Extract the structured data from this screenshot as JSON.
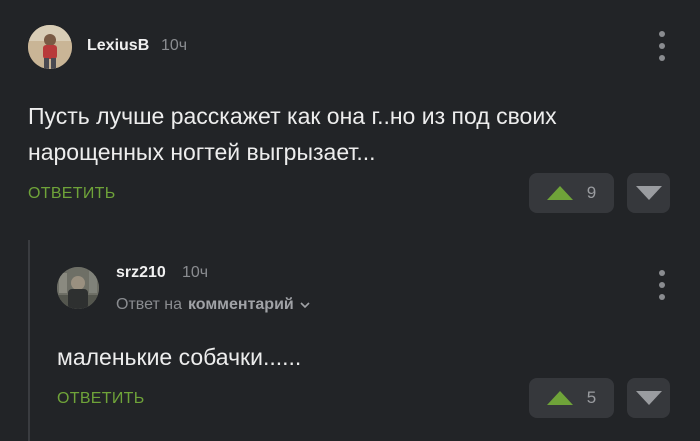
{
  "colors": {
    "background": "#222427",
    "accent_green": "#6fa339",
    "muted_text": "#8a8c90",
    "button_bg": "#36383c"
  },
  "comments": [
    {
      "author": "LexiusB",
      "time": "10ч",
      "text": "Пусть лучше расскажет как она г..но из под своих нарощенных ногтей выгрызает...",
      "reply_label": "ОТВЕТИТЬ",
      "rating": "9",
      "icons": {
        "upvote": "triangle-up-icon",
        "downvote": "triangle-down-icon",
        "menu": "kebab-menu-icon"
      }
    },
    {
      "author": "srz210",
      "time": "10ч",
      "reply_to_prefix": "Ответ на",
      "reply_to_target": "комментарий",
      "text": "маленькие собачки......",
      "reply_label": "ОТВЕТИТЬ",
      "rating": "5",
      "icons": {
        "upvote": "triangle-up-icon",
        "downvote": "triangle-down-icon",
        "menu": "kebab-menu-icon",
        "expand": "chevron-down-icon"
      }
    }
  ]
}
